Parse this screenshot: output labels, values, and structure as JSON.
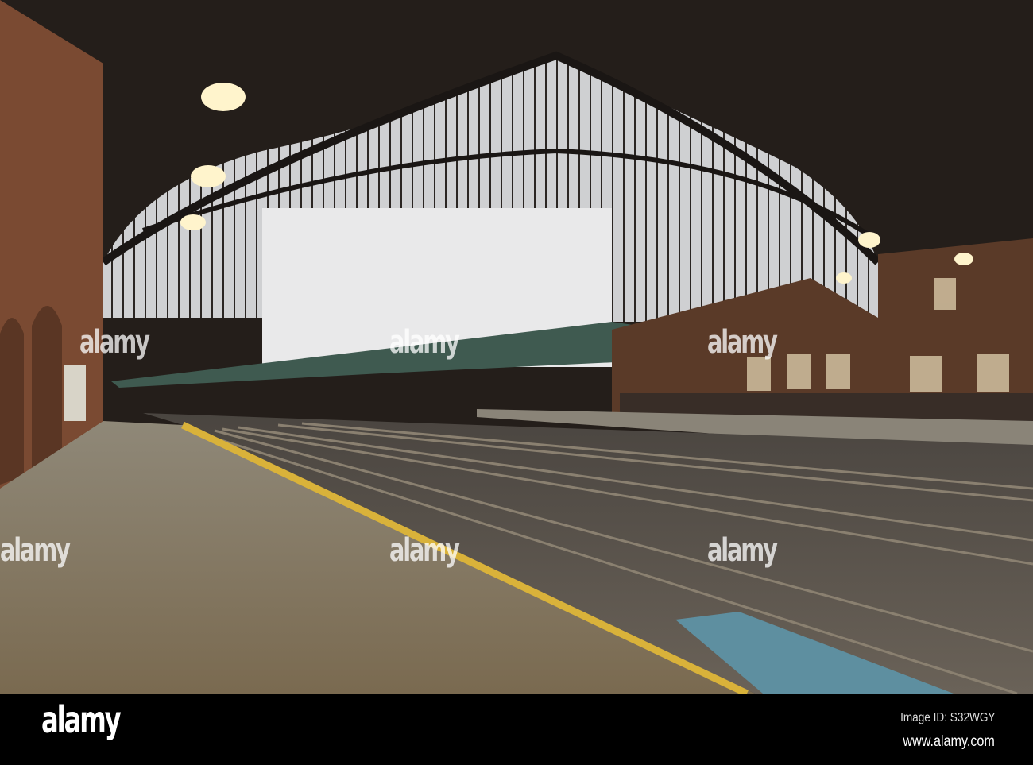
{
  "watermark": {
    "logo_text": "alamy",
    "image_id": "Image ID: S32WGY",
    "site": "www.alamy.com"
  },
  "colors": {
    "sky": "#e9e9ea",
    "roof": "#1e1a17",
    "platform": "#8a7a60",
    "yellow_line": "#d9b23a",
    "blue_patch": "#5e8fa0",
    "brick": "#7a4a32"
  }
}
